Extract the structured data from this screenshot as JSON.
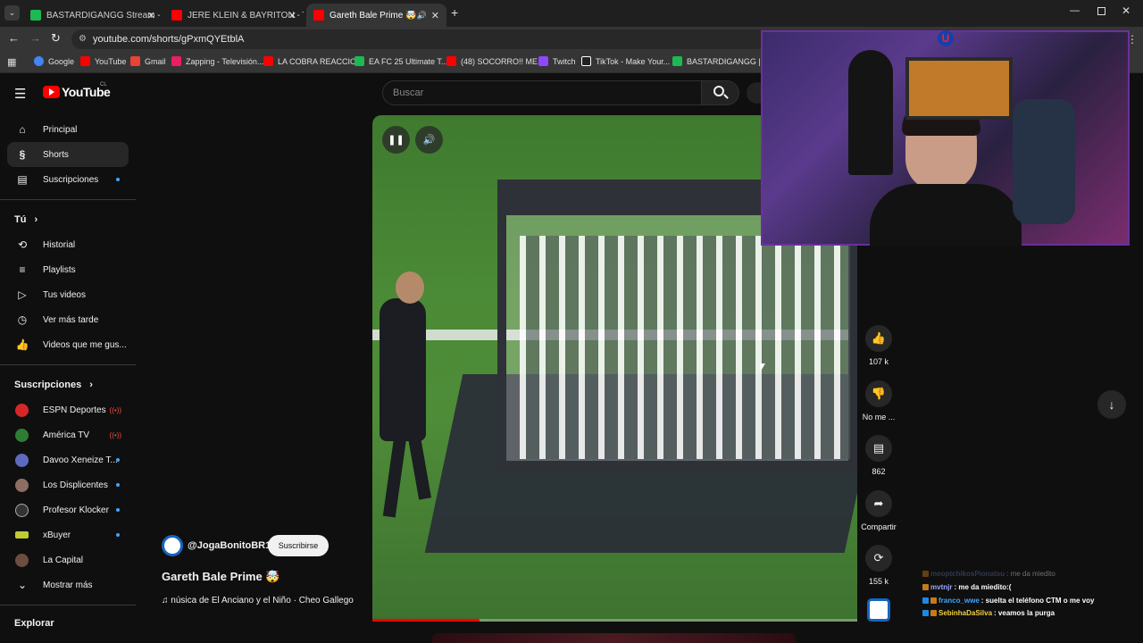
{
  "browser": {
    "tabs": [
      {
        "label": "BASTARDIGANGG Stream - Wa",
        "color": "#1db954"
      },
      {
        "label": "JERE KLEIN & BAYRITON - TU Y",
        "color": "#ff0000"
      },
      {
        "label": "Gareth Bale Prime 🤯 - You",
        "color": "#ff0000"
      }
    ],
    "url": "youtube.com/shorts/gPxmQYEtblA",
    "bookmarks": [
      {
        "label": "Google",
        "color": "#4285f4"
      },
      {
        "label": "YouTube",
        "color": "#ff0000"
      },
      {
        "label": "Gmail",
        "color": "#ea4335"
      },
      {
        "label": "Zapping - Televisión...",
        "color": "#e91e63"
      },
      {
        "label": "LA COBRA REACCIO...",
        "color": "#ff0000"
      },
      {
        "label": "EA FC 25 Ultimate T...",
        "color": "#1db954"
      },
      {
        "label": "(48) SOCORRO!! ME...",
        "color": "#ff0000"
      },
      {
        "label": "Twitch",
        "color": "#9146ff"
      },
      {
        "label": "TikTok - Make Your...",
        "color": "#ffffff"
      },
      {
        "label": "BASTARDIGANGG |...",
        "color": "#1db954"
      }
    ]
  },
  "youtube": {
    "logo": "YouTube",
    "region": "CL",
    "search_placeholder": "Buscar",
    "sidebar": {
      "main": [
        {
          "label": "Principal",
          "icon": "home-icon"
        },
        {
          "label": "Shorts",
          "icon": "shorts-icon"
        },
        {
          "label": "Suscripciones",
          "icon": "subscriptions-icon"
        }
      ],
      "you_header": "Tú",
      "you": [
        {
          "label": "Historial",
          "icon": "history-icon"
        },
        {
          "label": "Playlists",
          "icon": "playlist-icon"
        },
        {
          "label": "Tus videos",
          "icon": "video-icon"
        },
        {
          "label": "Ver más tarde",
          "icon": "clock-icon"
        },
        {
          "label": "Videos que me gus...",
          "icon": "like-icon"
        }
      ],
      "subs_header": "Suscripciones",
      "subs": [
        {
          "label": "ESPN Deportes",
          "color": "#d62728",
          "status": "live"
        },
        {
          "label": "América TV",
          "color": "#2e7d32",
          "status": "live"
        },
        {
          "label": "Davoo Xeneize T...",
          "color": "#5c6bc0",
          "status": "dot"
        },
        {
          "label": "Los Displicentes",
          "color": "#8d6e63",
          "status": "dot"
        },
        {
          "label": "Profesor Klocker",
          "color": "#222222",
          "status": "dot"
        },
        {
          "label": "xBuyer",
          "color": "#c0ca33",
          "status": "dot"
        },
        {
          "label": "La Capital",
          "color": "#6d4c41",
          "status": "none"
        }
      ],
      "more": "Mostrar más",
      "explore": "Explorar"
    },
    "short": {
      "channel": "@JogaBonitoBR1",
      "subscribe": "Suscribirse",
      "title": "Gareth Bale Prime 🤯",
      "music": "♫ núsica de El Anciano y el Niño · Cheo Gallego",
      "likes": "107 k",
      "dislike": "No me ...",
      "comments": "862",
      "share": "Compartir",
      "remix": "155 k"
    }
  },
  "chat": [
    {
      "user": "meoptchikosPionatsu",
      "msg": ": me da miedito",
      "color": "#5b6b9a"
    },
    {
      "user": "mvtnjr",
      "msg": ": me da miedito:(",
      "color": "#9aa7ff"
    },
    {
      "user": "franco_wwe",
      "msg": ": suelta el teléfono CTM o me voy",
      "color": "#3ea6ff"
    },
    {
      "user": "SebinhaDaSilva",
      "msg": ": veamos la purga",
      "color": "#f5d142"
    }
  ]
}
